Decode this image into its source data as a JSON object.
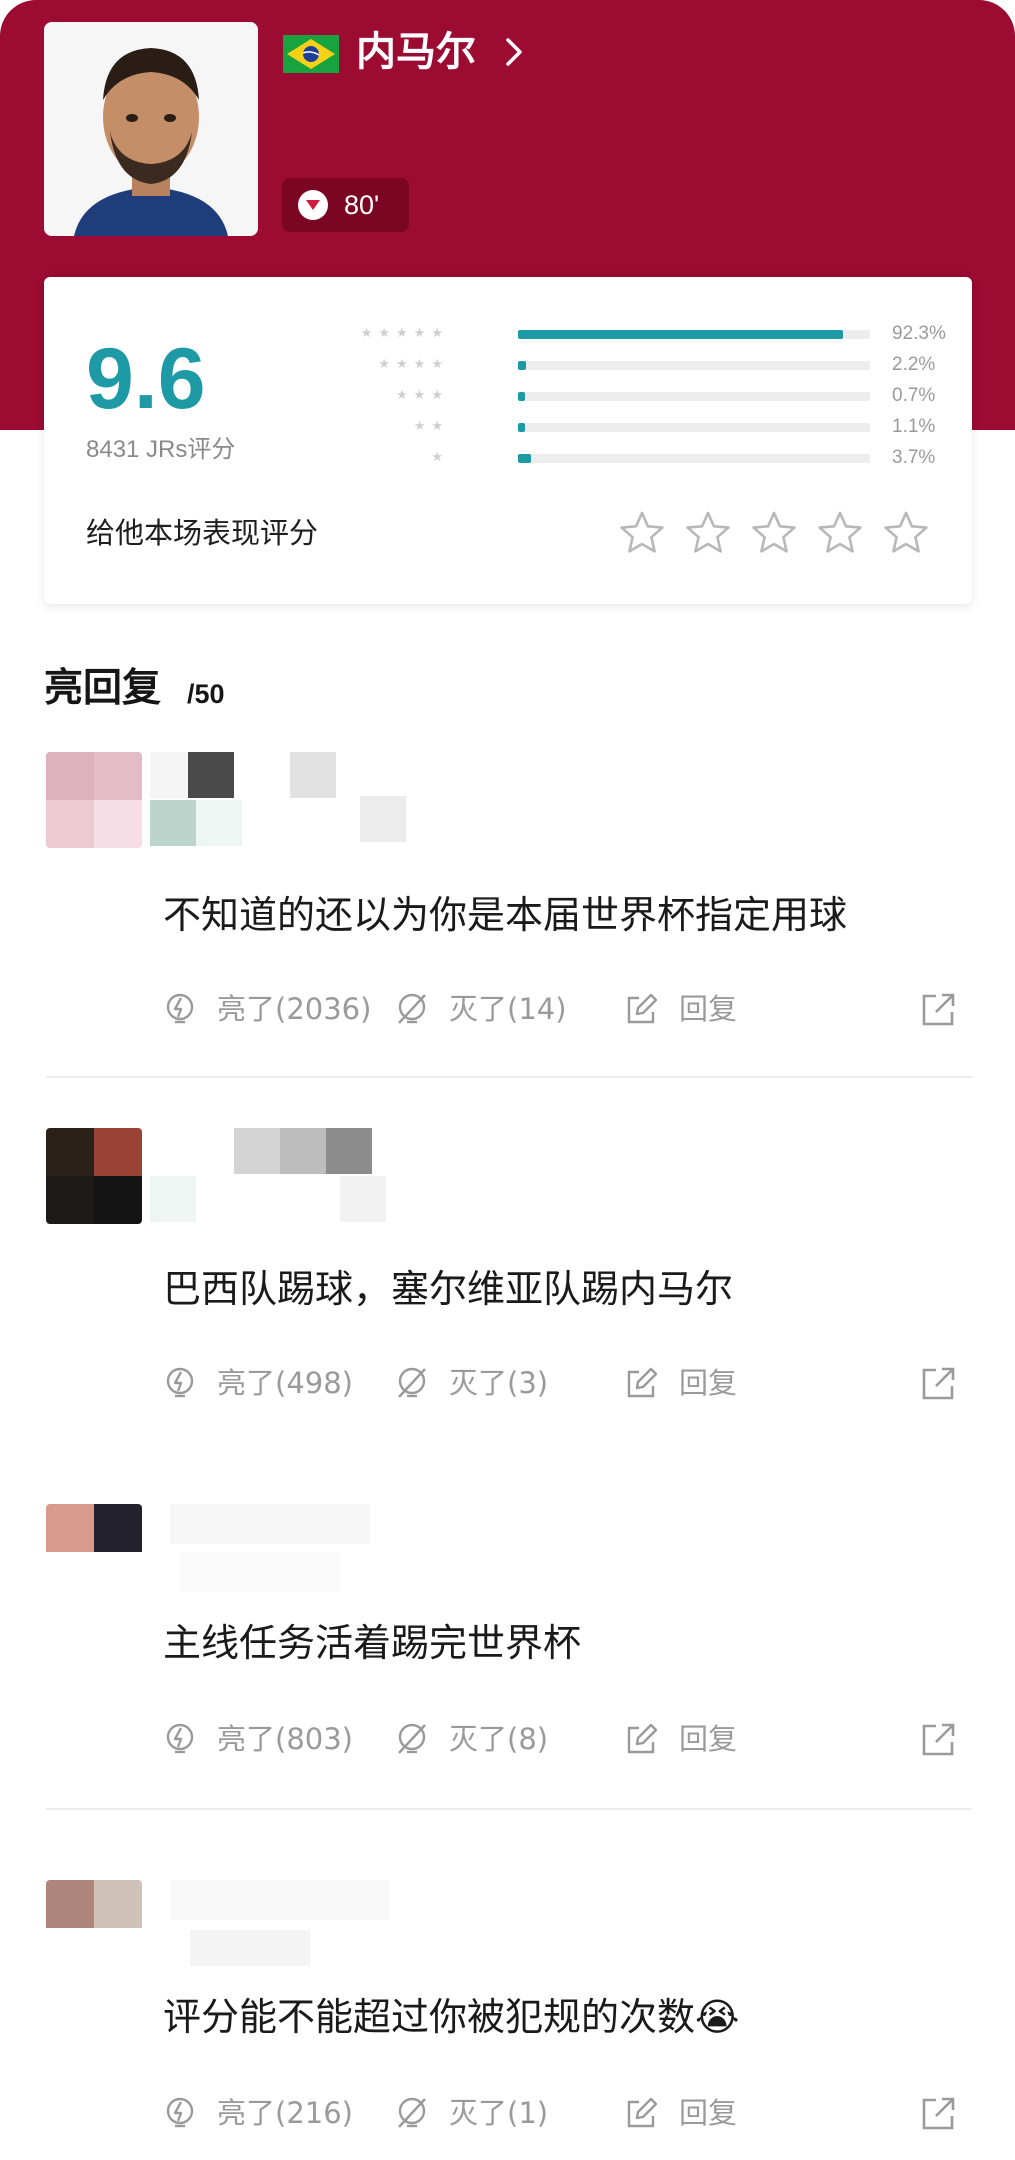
{
  "player": {
    "name": "内马尔",
    "sub_minute": "80'"
  },
  "rating": {
    "score": "9.6",
    "votes": "8431 JRs评分",
    "prompt": "给他本场表现评分",
    "distribution": [
      {
        "stars": 5,
        "percent": 92.3,
        "label": "92.3%"
      },
      {
        "stars": 4,
        "percent": 2.2,
        "label": "2.2%"
      },
      {
        "stars": 3,
        "percent": 0.7,
        "label": "0.7%"
      },
      {
        "stars": 2,
        "percent": 1.1,
        "label": "1.1%"
      },
      {
        "stars": 1,
        "percent": 3.7,
        "label": "3.7%"
      }
    ]
  },
  "section": {
    "title": "亮回复",
    "count": "/50"
  },
  "comments": [
    {
      "text": "不知道的还以为你是本届世界杯指定用球",
      "like": "亮了(2036)",
      "dislike": "灭了(14)",
      "reply": "回复"
    },
    {
      "text": "巴西队踢球，塞尔维亚队踢内马尔",
      "like": "亮了(498)",
      "dislike": "灭了(3)",
      "reply": "回复"
    },
    {
      "text": "主线任务活着踢完世界杯",
      "like": "亮了(803)",
      "dislike": "灭了(8)",
      "reply": "回复"
    },
    {
      "text": "评分能不能超过你被犯规的次数😭",
      "like": "亮了(216)",
      "dislike": "灭了(1)",
      "reply": "回复"
    }
  ],
  "colors": {
    "hero": "#9b0b32",
    "accent": "#1d9aa6",
    "muted": "#9a9a9a"
  }
}
